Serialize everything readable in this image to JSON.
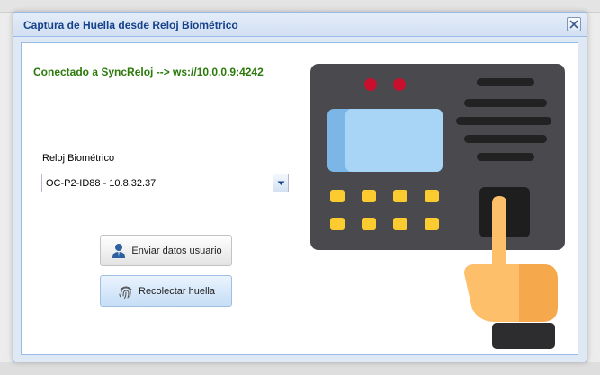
{
  "dialog": {
    "title": "Captura de Huella desde Reloj Biométrico",
    "close_icon": "close-icon"
  },
  "status": {
    "text": "Conectado a SyncReloj --> ws://10.0.0.9:4242",
    "color": "#2b7a0b"
  },
  "device_field": {
    "label": "Reloj Biométrico",
    "value": "OC-P2-ID88 - 10.8.32.37",
    "trigger_icon": "chevron-down-icon"
  },
  "buttons": {
    "send": {
      "label": "Enviar datos usuario",
      "icon": "user-icon"
    },
    "collect": {
      "label": "Recolectar huella",
      "icon": "fingerprint-icon"
    }
  },
  "illustration": {
    "icon": "biometric-clock-icon",
    "colors": {
      "body": "#4a4a4e",
      "screen": "#a8d4f5",
      "keys": "#fccb2f",
      "leds": "#c8102e",
      "hand": "#fdbf6a"
    }
  },
  "theme": {
    "title_color": "#15428b",
    "border": "#99bbe8"
  }
}
